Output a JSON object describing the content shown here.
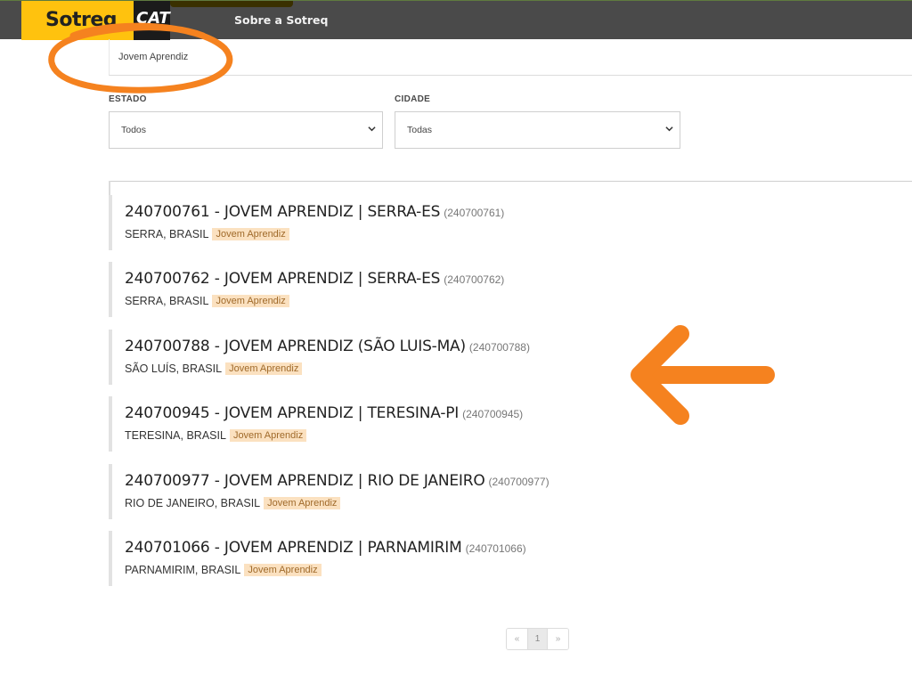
{
  "header": {
    "logo_sotreq": "Sotreq",
    "logo_cat": "CAT",
    "nav_link": "Sobre a Sotreq"
  },
  "search": {
    "value": "Jovem Aprendiz"
  },
  "filters": {
    "estado": {
      "label": "ESTADO",
      "selected": "Todos"
    },
    "cidade": {
      "label": "CIDADE",
      "selected": "Todas"
    }
  },
  "jobs": [
    {
      "title": "240700761 - JOVEM APRENDIZ | SERRA-ES",
      "id": "(240700761)",
      "location": "SERRA, BRASIL",
      "tag": "Jovem Aprendiz"
    },
    {
      "title": "240700762 - JOVEM APRENDIZ | SERRA-ES",
      "id": "(240700762)",
      "location": "SERRA, BRASIL",
      "tag": "Jovem Aprendiz"
    },
    {
      "title": "240700788 - JOVEM APRENDIZ (SÃO LUIS-MA)",
      "id": "(240700788)",
      "location": "SÃO LUÍS, BRASIL",
      "tag": "Jovem Aprendiz"
    },
    {
      "title": "240700945 - JOVEM APRENDIZ | TERESINA-PI",
      "id": "(240700945)",
      "location": "TERESINA, BRASIL",
      "tag": "Jovem Aprendiz"
    },
    {
      "title": "240700977 - JOVEM APRENDIZ | RIO DE JANEIRO",
      "id": "(240700977)",
      "location": "RIO DE JANEIRO, BRASIL",
      "tag": "Jovem Aprendiz"
    },
    {
      "title": "240701066 - JOVEM APRENDIZ | PARNAMIRIM",
      "id": "(240701066)",
      "location": "PARNAMIRIM, BRASIL",
      "tag": "Jovem Aprendiz"
    }
  ],
  "pagination": {
    "prev": "«",
    "current": "1",
    "next": "»"
  },
  "annotation": {
    "color": "#f5821f",
    "icons": [
      "highlight-ellipse",
      "arrow-left-icon"
    ]
  }
}
